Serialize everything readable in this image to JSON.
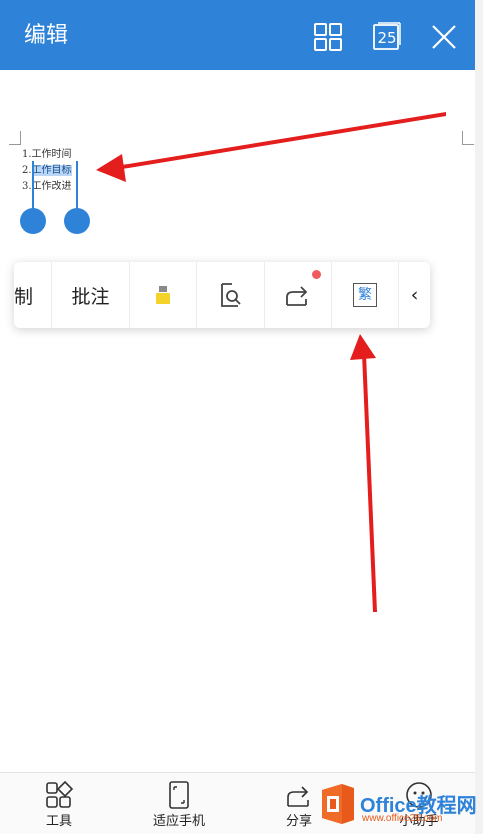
{
  "header": {
    "title": "编辑",
    "page_number": "25",
    "background_color": "#2e82d8",
    "icons": [
      "grid-icon",
      "page-count-icon",
      "close-icon"
    ]
  },
  "document": {
    "lines": [
      {
        "prefix": "1.",
        "text": "工作时间",
        "selected": false
      },
      {
        "prefix": "2.",
        "text": "工作目标",
        "selected": true
      },
      {
        "prefix": "3.",
        "text": "工作改进",
        "selected": false
      }
    ],
    "selection_color": "#b9d6f6"
  },
  "popup_toolbar": {
    "items": [
      {
        "label": "制",
        "kind": "text"
      },
      {
        "label": "批注",
        "kind": "text"
      },
      {
        "label": "",
        "kind": "highlighter-icon"
      },
      {
        "label": "",
        "kind": "search-icon"
      },
      {
        "label": "",
        "kind": "share-icon",
        "badge": true
      },
      {
        "label": "繁",
        "kind": "traditional-chinese-icon"
      },
      {
        "label": "‹",
        "kind": "chevron-left-icon"
      }
    ]
  },
  "bottom_bar": {
    "items": [
      {
        "label": "工具",
        "icon": "tools-icon"
      },
      {
        "label": "适应手机",
        "icon": "fit-phone-icon"
      },
      {
        "label": "分享",
        "icon": "share-icon"
      },
      {
        "label": "小助手",
        "icon": "assistant-icon"
      }
    ]
  },
  "watermark": {
    "text": "Office教程网",
    "url": "www.office26.com"
  },
  "annotation_color": "#e41d1d"
}
